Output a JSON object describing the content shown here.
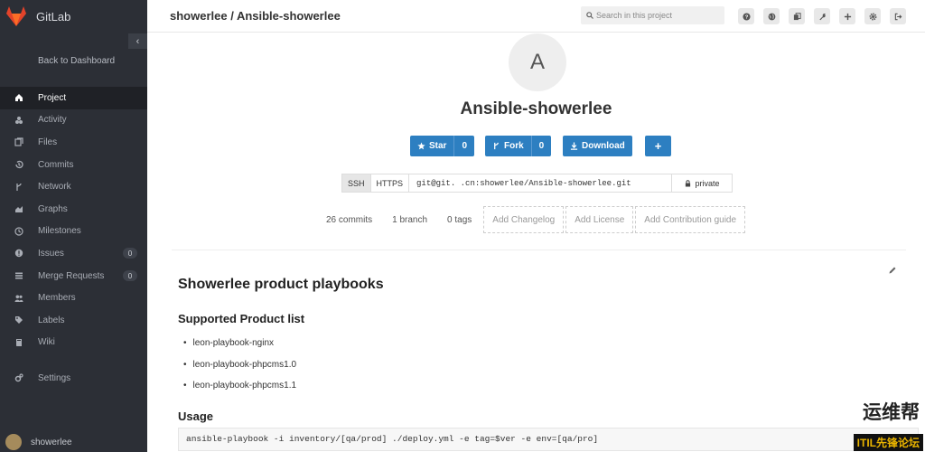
{
  "app": {
    "name": "GitLab"
  },
  "sidebar": {
    "collapse_symbol": "‹",
    "back_label": "Back to Dashboard",
    "items": [
      {
        "label": "Project",
        "icon": "home-icon",
        "active": true
      },
      {
        "label": "Activity",
        "icon": "dashboard-icon"
      },
      {
        "label": "Files",
        "icon": "files-icon"
      },
      {
        "label": "Commits",
        "icon": "history-icon"
      },
      {
        "label": "Network",
        "icon": "code-fork-icon"
      },
      {
        "label": "Graphs",
        "icon": "area-chart-icon"
      },
      {
        "label": "Milestones",
        "icon": "clock-icon"
      },
      {
        "label": "Issues",
        "icon": "exclamation-circle-icon",
        "badge": "0"
      },
      {
        "label": "Merge Requests",
        "icon": "list-icon",
        "badge": "0"
      },
      {
        "label": "Members",
        "icon": "users-icon"
      },
      {
        "label": "Labels",
        "icon": "tags-icon"
      },
      {
        "label": "Wiki",
        "icon": "book-icon"
      }
    ],
    "settings_label": "Settings",
    "user_name": "showerlee"
  },
  "header": {
    "title": "showerlee / Ansible-showerlee",
    "search_placeholder": "Search in this project",
    "icons": [
      "question-icon",
      "globe-icon",
      "copy-icon",
      "wrench-icon",
      "plus-icon",
      "gear-icon",
      "sign-out-icon"
    ]
  },
  "project": {
    "avatar_letter": "A",
    "name": "Ansible-showerlee",
    "star_label": "Star",
    "star_count": "0",
    "fork_label": "Fork",
    "fork_count": "0",
    "download_label": "Download",
    "add_label": "+",
    "clone": {
      "ssh_label": "SSH",
      "https_label": "HTTPS",
      "url": "git@git.        .cn:showerlee/Ansible-showerlee.git",
      "visibility": "private"
    },
    "stats": {
      "commits": "26 commits",
      "branches": "1 branch",
      "tags": "0 tags",
      "add_changelog": "Add Changelog",
      "add_license": "Add License",
      "add_contribution": "Add Contribution guide"
    }
  },
  "readme": {
    "title": "Showerlee product playbooks",
    "list_heading": "Supported Product list",
    "items": [
      "leon-playbook-nginx",
      "leon-playbook-phpcms1.0",
      "leon-playbook-phpcms1.1"
    ],
    "usage_heading": "Usage",
    "usage_code": "ansible-playbook -i inventory/[qa/prod] ./deploy.yml -e tag=$ver -e env=[qa/pro]"
  },
  "watermark": {
    "text": "运维帮",
    "sub": "ITIL先锋论坛"
  },
  "colors": {
    "sidebar": "#2c2f36",
    "primary": "#2d7fc1",
    "logo": "#e2432a"
  }
}
